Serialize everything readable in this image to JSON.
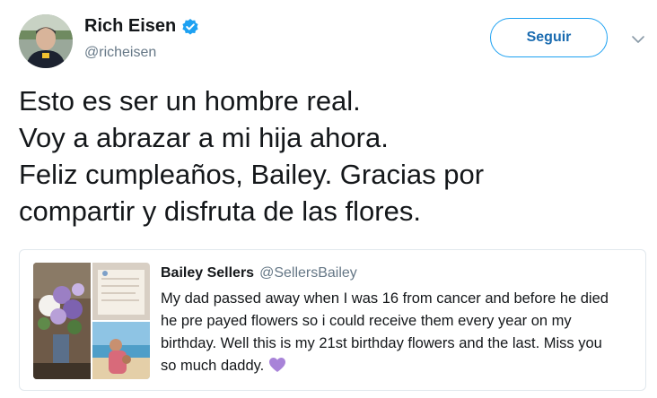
{
  "author": {
    "display_name": "Rich Eisen",
    "handle": "@richeisen",
    "verified_icon": "verified-badge-icon"
  },
  "follow_button": {
    "label": "Seguir"
  },
  "menu_icon": "chevron-down-icon",
  "tweet": {
    "lines": [
      "Esto es ser un hombre real.",
      "Voy a abrazar a mi hija ahora.",
      "Feliz cumpleaños, Bailey. Gracias por",
      "compartir y disfruta de las flores."
    ]
  },
  "quoted_tweet": {
    "display_name": "Bailey Sellers",
    "handle": "@SellersBailey",
    "lines": [
      "My dad passed away when I was 16 from cancer and before he died",
      "he pre payed flowers so i could receive them every year on my",
      "birthday. Well this is my 21st birthday flowers and the last. Miss you",
      "so much daddy."
    ],
    "emoji_icon": "purple-heart-icon"
  },
  "colors": {
    "accent": "#1da1f2",
    "secondary_text": "#657786",
    "border": "#e1e8ed",
    "purple_heart": "#a883d8"
  }
}
